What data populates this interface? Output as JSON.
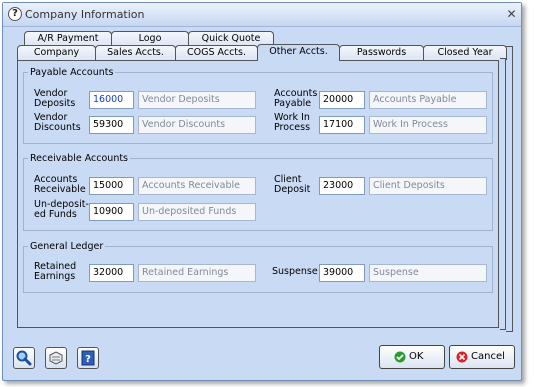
{
  "window": {
    "title": "Company Information"
  },
  "tabs_back": [
    "A/R Payment",
    "Logo",
    "Quick Quote"
  ],
  "tabs_front": [
    "Company",
    "Sales Accts.",
    "COGS Accts.",
    "Other Accts.",
    "Passwords",
    "Closed Year"
  ],
  "groups": {
    "payable": {
      "title": "Payable Accounts",
      "vendor_deposits": {
        "label": "Vendor\nDeposits",
        "number": "16000",
        "desc": "Vendor Deposits"
      },
      "vendor_discounts": {
        "label": "Vendor\nDiscounts",
        "number": "59300",
        "desc": "Vendor Discounts"
      },
      "accounts_payable": {
        "label": "Accounts\nPayable",
        "number": "20000",
        "desc": "Accounts Payable"
      },
      "work_in_process": {
        "label": "Work In\nProcess",
        "number": "17100",
        "desc": "Work In Process"
      }
    },
    "receivable": {
      "title": "Receivable Accounts",
      "accounts_receivable": {
        "label": "Accounts\nReceivable",
        "number": "15000",
        "desc": "Accounts Receivable"
      },
      "undeposited_funds": {
        "label": "Un-deposit-\ned Funds",
        "number": "10900",
        "desc": "Un-deposited Funds"
      },
      "client_deposit": {
        "label": "Client\nDeposit",
        "number": "23000",
        "desc": "Client Deposits"
      }
    },
    "ledger": {
      "title": "General Ledger",
      "retained_earnings": {
        "label": "Retained\nEarnings",
        "number": "32000",
        "desc": "Retained Earnings"
      },
      "suspense": {
        "label": "Suspense",
        "number": "39000",
        "desc": "Suspense"
      }
    }
  },
  "buttons": {
    "ok": "OK",
    "cancel": "Cancel"
  },
  "icons": {
    "title": "question-icon",
    "search": "magnifier-icon",
    "tools": "tools-icon",
    "help": "help-icon",
    "ok": "green-check-icon",
    "cancel": "red-x-icon"
  }
}
